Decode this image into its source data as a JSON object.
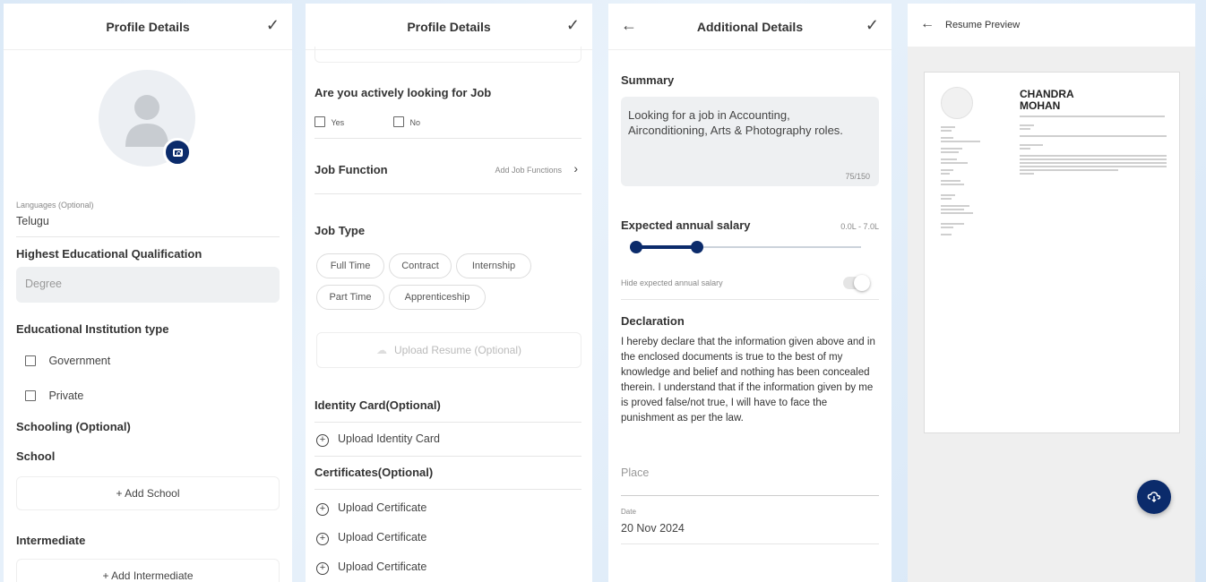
{
  "screen1": {
    "title": "Profile Details",
    "languages_label": "Languages (Optional)",
    "languages_value": "Telugu",
    "qualification_heading": "Highest Educational Qualification",
    "qualification_value": "Degree",
    "institution_heading": "Educational Institution type",
    "institution_options": [
      "Government",
      "Private"
    ],
    "schooling_heading": "Schooling (Optional)",
    "school_heading": "School",
    "add_school": "+ Add School",
    "intermediate_heading": "Intermediate",
    "add_intermediate": "+ Add Intermediate"
  },
  "screen2": {
    "title": "Profile Details",
    "job_seeking_question": "Are you actively looking for Job",
    "job_seeking_options": [
      "Yes",
      "No"
    ],
    "job_function_label": "Job Function",
    "job_function_action": "Add Job Functions",
    "job_type_label": "Job Type",
    "job_types": [
      "Full Time",
      "Contract",
      "Internship",
      "Part Time",
      "Apprenticeship"
    ],
    "upload_resume": "Upload Resume (Optional)",
    "identity_heading": "Identity Card(Optional)",
    "upload_identity": "Upload Identity Card",
    "certificates_heading": "Certificates(Optional)",
    "upload_certificates": [
      "Upload Certificate",
      "Upload Certificate",
      "Upload Certificate"
    ]
  },
  "screen3": {
    "title": "Additional Details",
    "summary_label": "Summary",
    "summary_text": "Looking for a job in Accounting, Airconditioning, Arts & Photography roles.",
    "summary_count": "75/150",
    "salary_label": "Expected annual salary",
    "salary_range": "0.0L - 7.0L",
    "salary_slider_min_fraction": 0.0,
    "salary_slider_max_fraction": 0.28,
    "hide_salary_label": "Hide expected annual salary",
    "declaration_label": "Declaration",
    "declaration_text": "I hereby declare that the information given above and in the enclosed documents is true to the best of my knowledge and belief and nothing has been concealed therein. I understand that if the information given by me is proved false/not true, I will have to face the punishment as per the law.",
    "place_placeholder": "Place",
    "date_label": "Date",
    "date_value": "20 Nov 2024"
  },
  "screen4": {
    "title": "Resume Preview",
    "resume_first_name": "CHANDRA",
    "resume_last_name": "MOHAN"
  },
  "colors": {
    "accent": "#0b2b6b",
    "background": "#dbe9f7"
  }
}
